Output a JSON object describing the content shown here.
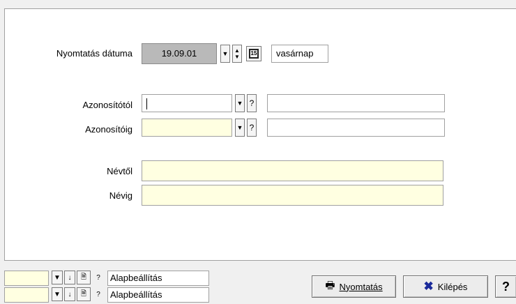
{
  "form": {
    "print_date_label": "Nyomtatás dátuma",
    "print_date_value": "19.09.01",
    "weekday_value": "vasárnap",
    "calendar_icon_text": "15",
    "id_from_label": "Azonosítótól",
    "id_from_value": "",
    "id_to_label": "Azonosítóig",
    "id_to_value": "",
    "name_from_label": "Névtől",
    "name_from_value": "",
    "name_to_label": "Névig",
    "name_to_value": ""
  },
  "bottom": {
    "preset1_label": "Alapbeállítás",
    "preset2_label": "Alapbeállítás",
    "print_button_label": "Nyomtatás",
    "exit_button_label": "Kilépés",
    "help_button_label": "?"
  },
  "icons": {
    "dropdown": "chevron-down-icon",
    "question": "help-icon",
    "spin": "spin-updown-icon",
    "calendar": "calendar-icon",
    "printer": "printer-icon",
    "exit": "x-icon"
  }
}
